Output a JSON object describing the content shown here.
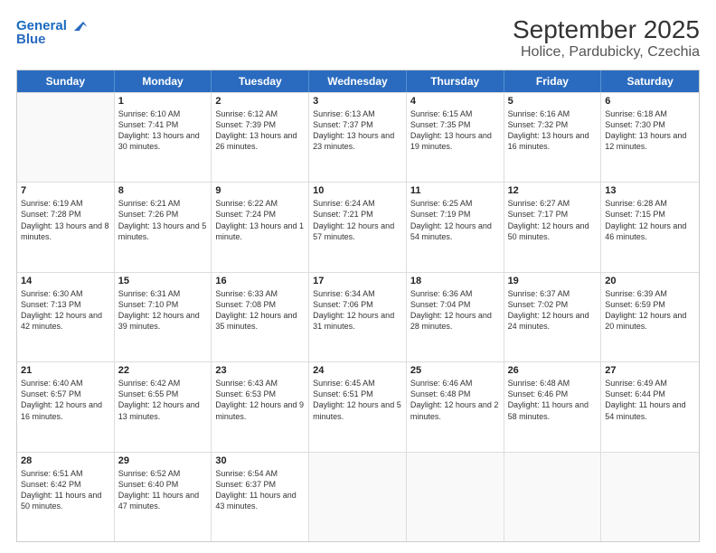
{
  "logo": {
    "line1": "General",
    "line2": "Blue"
  },
  "title": "September 2025",
  "subtitle": "Holice, Pardubicky, Czechia",
  "header_days": [
    "Sunday",
    "Monday",
    "Tuesday",
    "Wednesday",
    "Thursday",
    "Friday",
    "Saturday"
  ],
  "weeks": [
    [
      {
        "day": "",
        "sunrise": "",
        "sunset": "",
        "daylight": ""
      },
      {
        "day": "1",
        "sunrise": "Sunrise: 6:10 AM",
        "sunset": "Sunset: 7:41 PM",
        "daylight": "Daylight: 13 hours and 30 minutes."
      },
      {
        "day": "2",
        "sunrise": "Sunrise: 6:12 AM",
        "sunset": "Sunset: 7:39 PM",
        "daylight": "Daylight: 13 hours and 26 minutes."
      },
      {
        "day": "3",
        "sunrise": "Sunrise: 6:13 AM",
        "sunset": "Sunset: 7:37 PM",
        "daylight": "Daylight: 13 hours and 23 minutes."
      },
      {
        "day": "4",
        "sunrise": "Sunrise: 6:15 AM",
        "sunset": "Sunset: 7:35 PM",
        "daylight": "Daylight: 13 hours and 19 minutes."
      },
      {
        "day": "5",
        "sunrise": "Sunrise: 6:16 AM",
        "sunset": "Sunset: 7:32 PM",
        "daylight": "Daylight: 13 hours and 16 minutes."
      },
      {
        "day": "6",
        "sunrise": "Sunrise: 6:18 AM",
        "sunset": "Sunset: 7:30 PM",
        "daylight": "Daylight: 13 hours and 12 minutes."
      }
    ],
    [
      {
        "day": "7",
        "sunrise": "Sunrise: 6:19 AM",
        "sunset": "Sunset: 7:28 PM",
        "daylight": "Daylight: 13 hours and 8 minutes."
      },
      {
        "day": "8",
        "sunrise": "Sunrise: 6:21 AM",
        "sunset": "Sunset: 7:26 PM",
        "daylight": "Daylight: 13 hours and 5 minutes."
      },
      {
        "day": "9",
        "sunrise": "Sunrise: 6:22 AM",
        "sunset": "Sunset: 7:24 PM",
        "daylight": "Daylight: 13 hours and 1 minute."
      },
      {
        "day": "10",
        "sunrise": "Sunrise: 6:24 AM",
        "sunset": "Sunset: 7:21 PM",
        "daylight": "Daylight: 12 hours and 57 minutes."
      },
      {
        "day": "11",
        "sunrise": "Sunrise: 6:25 AM",
        "sunset": "Sunset: 7:19 PM",
        "daylight": "Daylight: 12 hours and 54 minutes."
      },
      {
        "day": "12",
        "sunrise": "Sunrise: 6:27 AM",
        "sunset": "Sunset: 7:17 PM",
        "daylight": "Daylight: 12 hours and 50 minutes."
      },
      {
        "day": "13",
        "sunrise": "Sunrise: 6:28 AM",
        "sunset": "Sunset: 7:15 PM",
        "daylight": "Daylight: 12 hours and 46 minutes."
      }
    ],
    [
      {
        "day": "14",
        "sunrise": "Sunrise: 6:30 AM",
        "sunset": "Sunset: 7:13 PM",
        "daylight": "Daylight: 12 hours and 42 minutes."
      },
      {
        "day": "15",
        "sunrise": "Sunrise: 6:31 AM",
        "sunset": "Sunset: 7:10 PM",
        "daylight": "Daylight: 12 hours and 39 minutes."
      },
      {
        "day": "16",
        "sunrise": "Sunrise: 6:33 AM",
        "sunset": "Sunset: 7:08 PM",
        "daylight": "Daylight: 12 hours and 35 minutes."
      },
      {
        "day": "17",
        "sunrise": "Sunrise: 6:34 AM",
        "sunset": "Sunset: 7:06 PM",
        "daylight": "Daylight: 12 hours and 31 minutes."
      },
      {
        "day": "18",
        "sunrise": "Sunrise: 6:36 AM",
        "sunset": "Sunset: 7:04 PM",
        "daylight": "Daylight: 12 hours and 28 minutes."
      },
      {
        "day": "19",
        "sunrise": "Sunrise: 6:37 AM",
        "sunset": "Sunset: 7:02 PM",
        "daylight": "Daylight: 12 hours and 24 minutes."
      },
      {
        "day": "20",
        "sunrise": "Sunrise: 6:39 AM",
        "sunset": "Sunset: 6:59 PM",
        "daylight": "Daylight: 12 hours and 20 minutes."
      }
    ],
    [
      {
        "day": "21",
        "sunrise": "Sunrise: 6:40 AM",
        "sunset": "Sunset: 6:57 PM",
        "daylight": "Daylight: 12 hours and 16 minutes."
      },
      {
        "day": "22",
        "sunrise": "Sunrise: 6:42 AM",
        "sunset": "Sunset: 6:55 PM",
        "daylight": "Daylight: 12 hours and 13 minutes."
      },
      {
        "day": "23",
        "sunrise": "Sunrise: 6:43 AM",
        "sunset": "Sunset: 6:53 PM",
        "daylight": "Daylight: 12 hours and 9 minutes."
      },
      {
        "day": "24",
        "sunrise": "Sunrise: 6:45 AM",
        "sunset": "Sunset: 6:51 PM",
        "daylight": "Daylight: 12 hours and 5 minutes."
      },
      {
        "day": "25",
        "sunrise": "Sunrise: 6:46 AM",
        "sunset": "Sunset: 6:48 PM",
        "daylight": "Daylight: 12 hours and 2 minutes."
      },
      {
        "day": "26",
        "sunrise": "Sunrise: 6:48 AM",
        "sunset": "Sunset: 6:46 PM",
        "daylight": "Daylight: 11 hours and 58 minutes."
      },
      {
        "day": "27",
        "sunrise": "Sunrise: 6:49 AM",
        "sunset": "Sunset: 6:44 PM",
        "daylight": "Daylight: 11 hours and 54 minutes."
      }
    ],
    [
      {
        "day": "28",
        "sunrise": "Sunrise: 6:51 AM",
        "sunset": "Sunset: 6:42 PM",
        "daylight": "Daylight: 11 hours and 50 minutes."
      },
      {
        "day": "29",
        "sunrise": "Sunrise: 6:52 AM",
        "sunset": "Sunset: 6:40 PM",
        "daylight": "Daylight: 11 hours and 47 minutes."
      },
      {
        "day": "30",
        "sunrise": "Sunrise: 6:54 AM",
        "sunset": "Sunset: 6:37 PM",
        "daylight": "Daylight: 11 hours and 43 minutes."
      },
      {
        "day": "",
        "sunrise": "",
        "sunset": "",
        "daylight": ""
      },
      {
        "day": "",
        "sunrise": "",
        "sunset": "",
        "daylight": ""
      },
      {
        "day": "",
        "sunrise": "",
        "sunset": "",
        "daylight": ""
      },
      {
        "day": "",
        "sunrise": "",
        "sunset": "",
        "daylight": ""
      }
    ]
  ]
}
